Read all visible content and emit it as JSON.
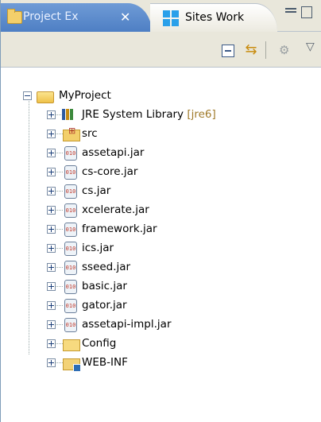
{
  "tabs": [
    {
      "label": "Project Ex",
      "active": true,
      "close_glyph": "✕"
    },
    {
      "label": "Sites Work",
      "active": false
    }
  ],
  "toolbar": {
    "collapse_icon": "collapse-all-icon",
    "link_icon": "link-with-editor-icon",
    "filter_icon": "filters-icon",
    "menu_icon": "view-menu-icon"
  },
  "tree": {
    "root": {
      "label": "MyProject",
      "expanded": true
    },
    "items": [
      {
        "label": "JRE System Library",
        "suffix": "[jre6]",
        "icon": "library-icon"
      },
      {
        "label": "src",
        "icon": "source-folder-icon"
      },
      {
        "label": "assetapi.jar",
        "icon": "jar-icon"
      },
      {
        "label": "cs-core.jar",
        "icon": "jar-icon"
      },
      {
        "label": "cs.jar",
        "icon": "jar-icon"
      },
      {
        "label": "xcelerate.jar",
        "icon": "jar-icon"
      },
      {
        "label": "framework.jar",
        "icon": "jar-icon"
      },
      {
        "label": "ics.jar",
        "icon": "jar-icon"
      },
      {
        "label": "sseed.jar",
        "icon": "jar-icon"
      },
      {
        "label": "basic.jar",
        "icon": "jar-icon"
      },
      {
        "label": "gator.jar",
        "icon": "jar-icon"
      },
      {
        "label": "assetapi-impl.jar",
        "icon": "jar-icon"
      },
      {
        "label": "Config",
        "icon": "folder-icon"
      },
      {
        "label": "WEB-INF",
        "icon": "web-folder-icon"
      }
    ]
  },
  "colors": {
    "active_tab": "#5a8ad0",
    "panel_bg": "#e9e7db",
    "jre_suffix": "#a07a2a"
  }
}
